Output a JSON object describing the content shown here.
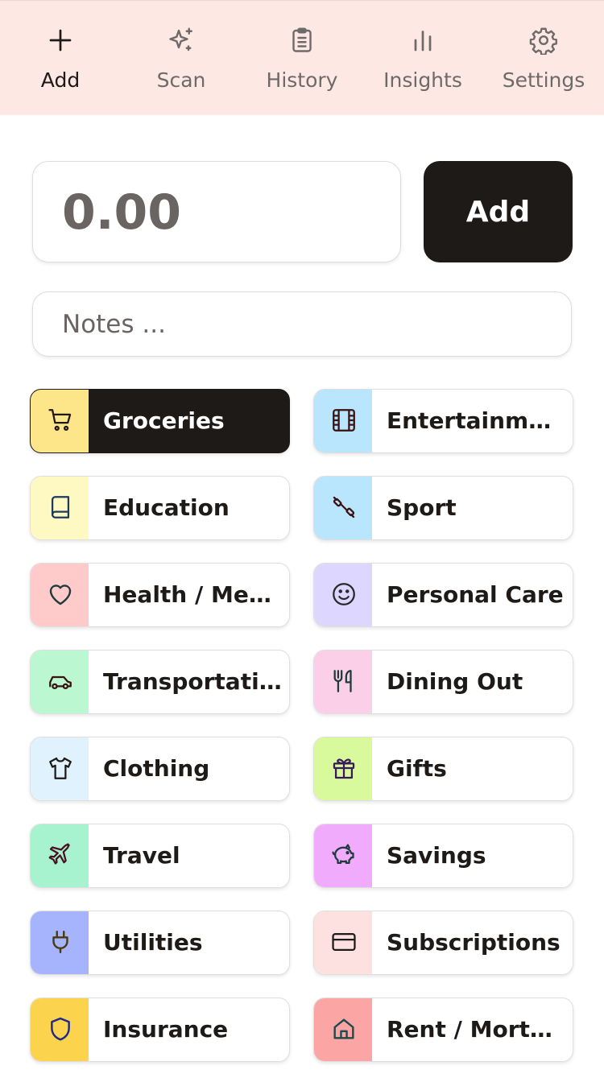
{
  "nav": {
    "items": [
      {
        "label": "Add",
        "icon": "plus-icon",
        "active": true
      },
      {
        "label": "Scan",
        "icon": "sparkles-icon",
        "active": false
      },
      {
        "label": "History",
        "icon": "clipboard-icon",
        "active": false
      },
      {
        "label": "Insights",
        "icon": "bar-chart-icon",
        "active": false
      },
      {
        "label": "Settings",
        "icon": "gear-icon",
        "active": false
      }
    ]
  },
  "amount": {
    "placeholder": "0.00",
    "value": ""
  },
  "add_button": {
    "label": "Add"
  },
  "notes": {
    "placeholder": "Notes ...",
    "value": ""
  },
  "categories": [
    {
      "label": "Groceries",
      "icon": "cart-icon",
      "color": "#fde68a",
      "selected": true
    },
    {
      "label": "Entertainment",
      "icon": "film-icon",
      "color": "#bae6fd",
      "selected": false
    },
    {
      "label": "Education",
      "icon": "book-icon",
      "color": "#fef9c3",
      "selected": false
    },
    {
      "label": "Sport",
      "icon": "dumbbell-icon",
      "color": "#bae6fd",
      "selected": false
    },
    {
      "label": "Health / Medical",
      "icon": "heart-icon",
      "color": "#fecaca",
      "selected": false
    },
    {
      "label": "Personal Care",
      "icon": "smile-icon",
      "color": "#ddd6fe",
      "selected": false
    },
    {
      "label": "Transportation",
      "icon": "car-icon",
      "color": "#bbf7d0",
      "selected": false
    },
    {
      "label": "Dining Out",
      "icon": "utensils-icon",
      "color": "#fbcfe8",
      "selected": false
    },
    {
      "label": "Clothing",
      "icon": "shirt-icon",
      "color": "#e0f2fe",
      "selected": false
    },
    {
      "label": "Gifts",
      "icon": "gift-icon",
      "color": "#d9f99d",
      "selected": false
    },
    {
      "label": "Travel",
      "icon": "plane-icon",
      "color": "#a7f3d0",
      "selected": false
    },
    {
      "label": "Savings",
      "icon": "piggy-bank-icon",
      "color": "#f0abfc",
      "selected": false
    },
    {
      "label": "Utilities",
      "icon": "plug-icon",
      "color": "#a5b4fc",
      "selected": false
    },
    {
      "label": "Subscriptions",
      "icon": "credit-card-icon",
      "color": "#fde0e0",
      "selected": false
    },
    {
      "label": "Insurance",
      "icon": "shield-icon",
      "color": "#fcd34d",
      "selected": false
    },
    {
      "label": "Rent / Mortgage",
      "icon": "home-icon",
      "color": "#fca5a5",
      "selected": false
    }
  ]
}
